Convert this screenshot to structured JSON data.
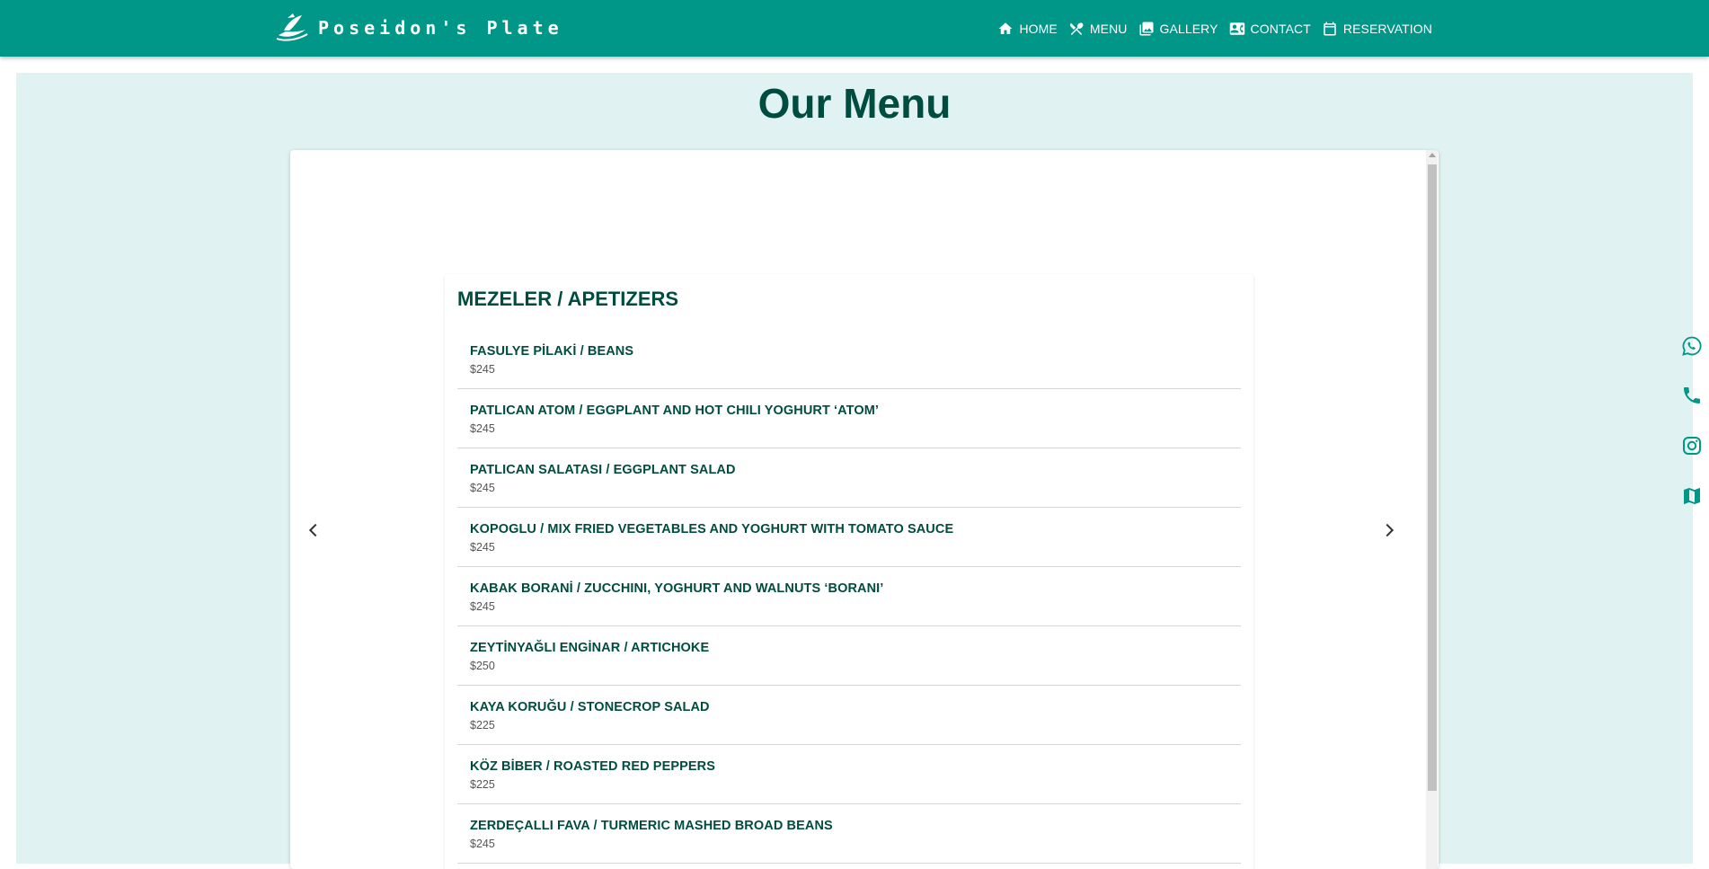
{
  "brand": {
    "title": "Poseidon's Plate"
  },
  "nav": {
    "items": [
      {
        "label": "HOME",
        "icon": "home-icon"
      },
      {
        "label": "MENU",
        "icon": "restaurant-icon"
      },
      {
        "label": "GALLERY",
        "icon": "gallery-icon"
      },
      {
        "label": "CONTACT",
        "icon": "contact-card-icon"
      },
      {
        "label": "RESERVATION",
        "icon": "calendar-icon"
      }
    ]
  },
  "menu": {
    "heading": "Our Menu",
    "category": "MEZELER / APETIZERS",
    "items": [
      {
        "name": "FASULYE PİLAKİ / BEANS",
        "price": "$245"
      },
      {
        "name": "PATLICAN ATOM / EGGPLANT AND HOT CHILI YOGHURT ‘ATOM’",
        "price": "$245"
      },
      {
        "name": "PATLICAN SALATASI / EGGPLANT SALAD",
        "price": "$245"
      },
      {
        "name": "KOPOGLU / MIX FRIED VEGETABLES AND YOGHURT WITH TOMATO SAUCE",
        "price": "$245"
      },
      {
        "name": "KABAK BORANİ / ZUCCHINI, YOGHURT AND WALNUTS ‘BORANI’",
        "price": "$245"
      },
      {
        "name": "ZEYTİNYAĞLI ENGİNAR / ARTICHOKE",
        "price": "$250"
      },
      {
        "name": "KAYA KORUĞU / STONECROP SALAD",
        "price": "$225"
      },
      {
        "name": "KÖZ BİBER / ROASTED RED PEPPERS",
        "price": "$225"
      },
      {
        "name": "ZERDEÇALLI FAVA / TURMERIC MASHED BROAD BEANS",
        "price": "$245"
      }
    ]
  },
  "social": [
    "whatsapp-icon",
    "phone-icon",
    "instagram-icon",
    "map-icon"
  ],
  "colors": {
    "primary": "#009688",
    "dark_teal": "#004d40",
    "section_bg": "#e0f2f1"
  }
}
